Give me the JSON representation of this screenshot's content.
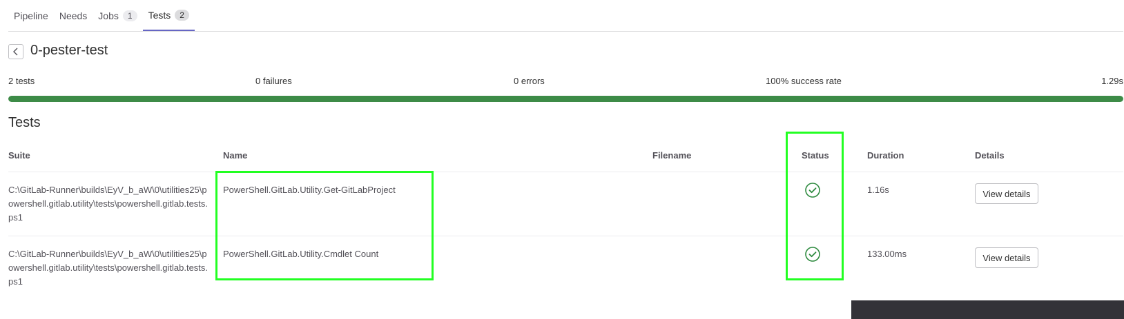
{
  "tabs": [
    {
      "label": "Pipeline",
      "count": null
    },
    {
      "label": "Needs",
      "count": null
    },
    {
      "label": "Jobs",
      "count": "1"
    },
    {
      "label": "Tests",
      "count": "2"
    }
  ],
  "header": {
    "title": "0-pester-test"
  },
  "summary": {
    "tests": "2 tests",
    "failures": "0 failures",
    "errors": "0 errors",
    "success_rate": "100% success rate",
    "duration": "1.29s",
    "success_fraction": 1.0
  },
  "section_title": "Tests",
  "table": {
    "headers": [
      "Suite",
      "Name",
      "Filename",
      "Status",
      "Duration",
      "Details"
    ],
    "rows": [
      {
        "suite": "C:\\GitLab-Runner\\builds\\EyV_b_aW\\0\\utilities25\\powershell.gitlab.utility\\tests\\powershell.gitlab.tests.ps1",
        "name": "PowerShell.GitLab.Utility.Get-GitLabProject",
        "filename": "",
        "status": "success-icon",
        "duration": "1.16s",
        "details": "View details"
      },
      {
        "suite": "C:\\GitLab-Runner\\builds\\EyV_b_aW\\0\\utilities25\\powershell.gitlab.utility\\tests\\powershell.gitlab.tests.ps1",
        "name": "PowerShell.GitLab.Utility.Cmdlet Count",
        "filename": "",
        "status": "success-icon",
        "duration": "133.00ms",
        "details": "View details"
      }
    ]
  },
  "colors": {
    "success": "#2d8a3e",
    "progress": "#3d8b47",
    "highlight": "#22ff22",
    "tab_active": "#6666c4"
  }
}
